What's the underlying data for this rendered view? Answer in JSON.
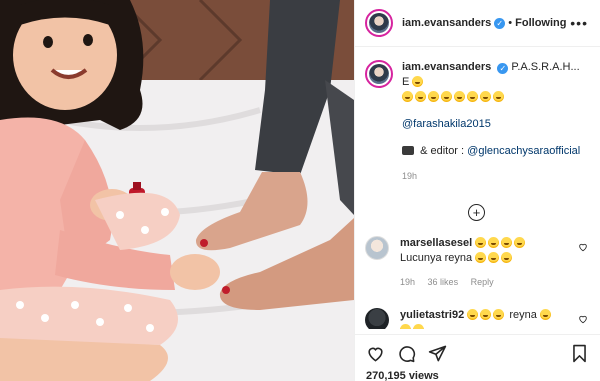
{
  "header": {
    "username": "iam.evansanders",
    "dot": "•",
    "follow_status": "Following",
    "more": "•••"
  },
  "caption": {
    "username": "iam.evansanders",
    "text": "P.A.S.R.A.H... E",
    "mention1": "@farashakila2015",
    "editor_prefix": "& editor :",
    "mention2": "@glencachysaraofficial",
    "time": "19h"
  },
  "comments": [
    {
      "username": "marsellasesel",
      "text": "Lucunya reyna",
      "time": "19h",
      "likes": "36 likes",
      "reply": "Reply"
    },
    {
      "username": "yulietastri92",
      "text": "reyna",
      "time": "",
      "likes": "",
      "reply": ""
    }
  ],
  "actions": {
    "views": "270,195 views"
  },
  "colors": {
    "verified": "#3897f0",
    "mention": "#00376b",
    "meta": "#8e8e8e",
    "story_ring": "#d6249f"
  }
}
